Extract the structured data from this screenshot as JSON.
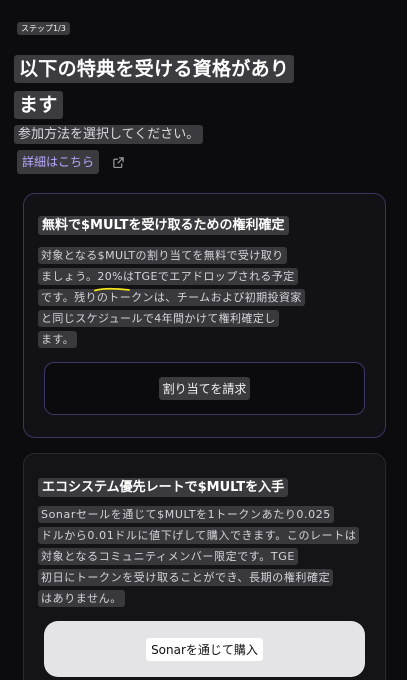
{
  "step": {
    "label": "ステップ1/3"
  },
  "header": {
    "title_line1": "以下の特典を受ける資格があり",
    "title_line2": "ます",
    "subtitle": "参加方法を選択してください。",
    "details_link": "詳細はこちら",
    "details_icon": "external-link-icon"
  },
  "colors": {
    "background": "#0c0c0e",
    "accent": "#b9a9ff",
    "card1_border": "#3b3562",
    "underline": "#f5e21b",
    "buy_button": "#e4e4e6"
  },
  "card1": {
    "title": "無料で$MULTを受け取るための権利確定",
    "body_line1": "対象となる$MULTの割り当てを無料で受け取り",
    "body_line2_pre": "ましょう。",
    "body_line2_pct": "20%",
    "body_line2_post": "はTGEでエアドロップされる予定",
    "body_line3": "です。残りのトークンは、チームおよび初期投資家",
    "body_line4": "と同じスケジュールで4年間かけて権利確定し",
    "body_line5": "ます。",
    "button_label": "割り当てを請求"
  },
  "card2": {
    "title": "エコシステム優先レートで$MULTを入手",
    "body_line1": "Sonarセールを通じて$MULTを1トークンあたり0.025",
    "body_line2": "ドルから0.01ドルに値下げして購入できます。このレートは",
    "body_line3": "対象となるコミュニティメンバー限定です。TGE",
    "body_line4": "初日にトークンを受け取ることができ、長期の権利確定",
    "body_line5": "はありません。",
    "button_label": "Sonarを通じて購入"
  }
}
